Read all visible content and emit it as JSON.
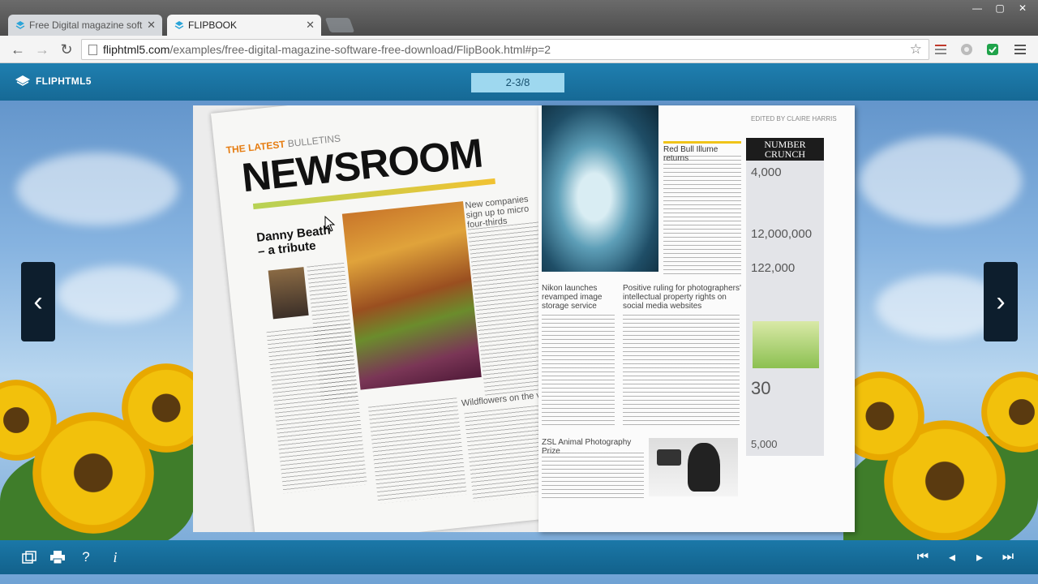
{
  "browser": {
    "tabs": [
      {
        "title": "Free Digital magazine soft",
        "active": false
      },
      {
        "title": "FLIPBOOK",
        "active": true
      }
    ],
    "url_host": "fliphtml5.com",
    "url_path": "/examples/free-digital-magazine-software-free-download/FlipBook.html#p=2"
  },
  "viewer": {
    "logo_text": "FLIPHTML5",
    "page_indicator": "2-3/8"
  },
  "magazine": {
    "left": {
      "kicker_bold": "THE LATEST",
      "kicker_thin": "BULLETINS",
      "headline": "NEWSROOM",
      "story_title_1": "Danny Beath",
      "story_title_2": "– a tribute",
      "sidebar_head": "New companies sign up to micro four-thirds",
      "bottom_head": "Wildflowers on the verge"
    },
    "right": {
      "edited_by": "EDITED BY CLAIRE HARRIS",
      "red_bull_title": "Red Bull Illume returns",
      "number_crunch_1": "NUMBER",
      "number_crunch_2": "CRUNCH",
      "numbers": [
        "4,000",
        "12,000,000",
        "122,000",
        "30",
        "5,000"
      ],
      "nikon_head": "Nikon launches revamped image storage service",
      "ruling_head": "Positive ruling for photographers' intellectual property rights on social media websites",
      "prize_head": "ZSL Animal Photography Prize"
    }
  }
}
